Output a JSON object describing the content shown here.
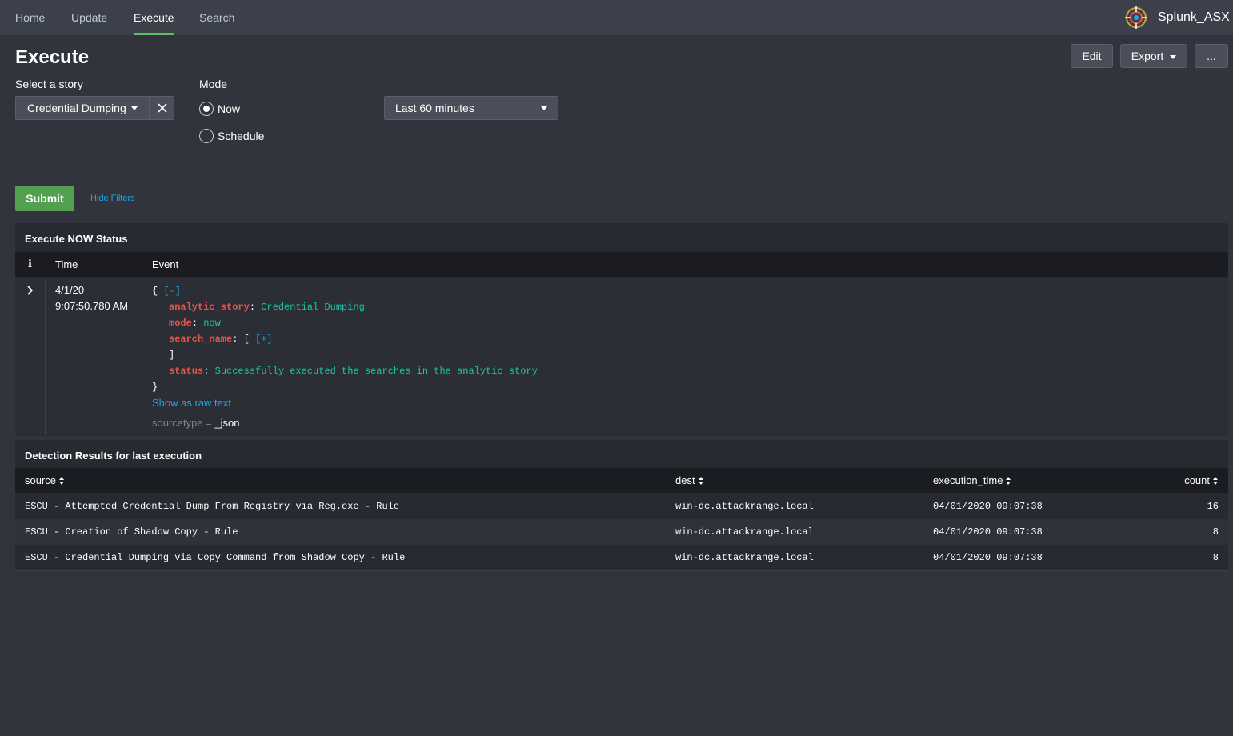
{
  "nav": {
    "items": [
      {
        "label": "Home"
      },
      {
        "label": "Update"
      },
      {
        "label": "Execute"
      },
      {
        "label": "Search"
      }
    ],
    "active": "Execute",
    "app_name": "Splunk_ASX",
    "app_icon": "crosshair-icon"
  },
  "header": {
    "title": "Execute",
    "edit_label": "Edit",
    "export_label": "Export",
    "more_label": "..."
  },
  "filters": {
    "story_label": "Select a story",
    "story_value": "Credential Dumping",
    "mode_label": "Mode",
    "mode_options": [
      "Now",
      "Schedule"
    ],
    "mode_selected": "Now",
    "time_range": "Last 60 minutes",
    "submit_label": "Submit",
    "hide_filters_label": "Hide Filters"
  },
  "status_panel": {
    "title": "Execute NOW Status",
    "columns": {
      "info": "i",
      "time": "Time",
      "event": "Event"
    },
    "event": {
      "date": "4/1/20",
      "time": "9:07:50.780 AM",
      "collapse_toggle": "[-]",
      "expand_toggle": "[+]",
      "fields": {
        "analytic_story_key": "analytic_story",
        "analytic_story_value": "Credential Dumping",
        "mode_key": "mode",
        "mode_value": "now",
        "search_name_key": "search_name",
        "status_key": "status",
        "status_value": "Successfully executed the searches in the analytic story"
      },
      "show_raw_label": "Show as raw text",
      "sourcetype_label": "sourcetype =",
      "sourcetype_value": "_json"
    }
  },
  "results_panel": {
    "title": "Detection Results for last execution",
    "columns": [
      "source",
      "dest",
      "execution_time",
      "count"
    ],
    "rows": [
      {
        "source": "ESCU - Attempted Credential Dump From Registry via Reg.exe - Rule",
        "dest": "win-dc.attackrange.local",
        "execution_time": "04/01/2020 09:07:38",
        "count": "16"
      },
      {
        "source": "ESCU - Creation of Shadow Copy - Rule",
        "dest": "win-dc.attackrange.local",
        "execution_time": "04/01/2020 09:07:38",
        "count": "8"
      },
      {
        "source": "ESCU - Credential Dumping via Copy Command from Shadow Copy - Rule",
        "dest": "win-dc.attackrange.local",
        "execution_time": "04/01/2020 09:07:38",
        "count": "8"
      }
    ]
  },
  "colors": {
    "accent": "#5cc05c",
    "link": "#1aa7ec",
    "json_key": "#e8544a",
    "json_value": "#1ec4a4",
    "submit": "#53a051"
  }
}
